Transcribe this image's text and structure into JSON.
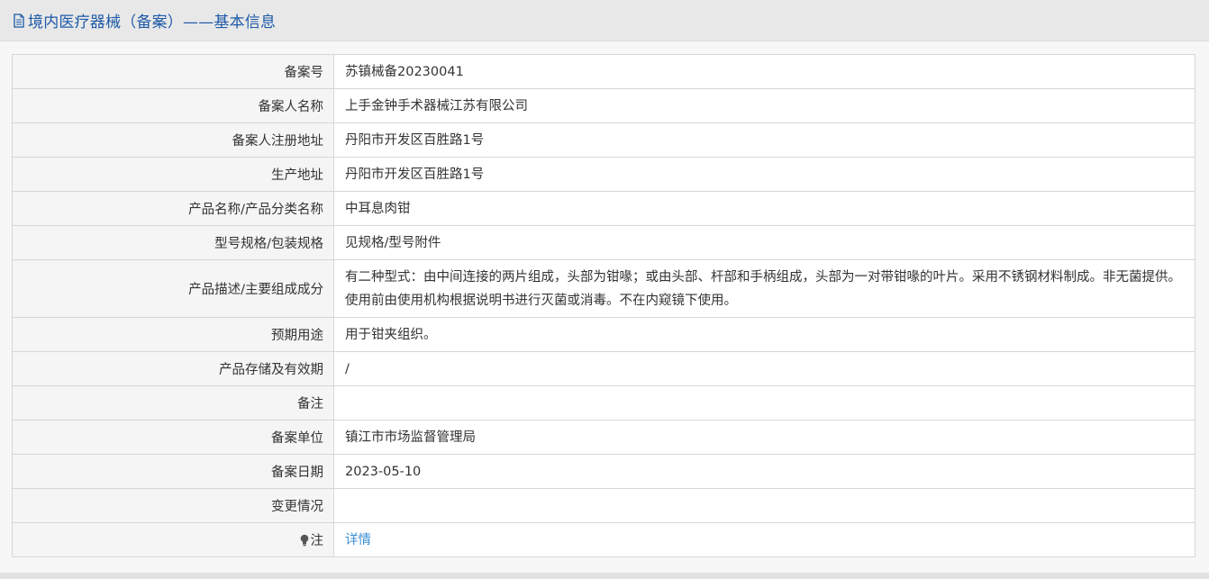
{
  "header": {
    "title": "境内医疗器械（备案）——基本信息",
    "icon": "document-icon"
  },
  "fields": [
    {
      "label": "备案号",
      "value": "苏镇械备20230041"
    },
    {
      "label": "备案人名称",
      "value": "上手金钟手术器械江苏有限公司"
    },
    {
      "label": "备案人注册地址",
      "value": "丹阳市开发区百胜路1号"
    },
    {
      "label": "生产地址",
      "value": "丹阳市开发区百胜路1号"
    },
    {
      "label": "产品名称/产品分类名称",
      "value": "中耳息肉钳"
    },
    {
      "label": "型号规格/包装规格",
      "value": "见规格/型号附件"
    },
    {
      "label": "产品描述/主要组成成分",
      "value": "有二种型式：由中间连接的两片组成，头部为钳喙；或由头部、杆部和手柄组成，头部为一对带钳喙的叶片。采用不锈钢材料制成。非无菌提供。使用前由使用机构根据说明书进行灭菌或消毒。不在内窥镜下使用。"
    },
    {
      "label": "预期用途",
      "value": "用于钳夹组织。"
    },
    {
      "label": "产品存储及有效期",
      "value": "/"
    },
    {
      "label": "备注",
      "value": ""
    },
    {
      "label": "备案单位",
      "value": "镇江市市场监督管理局"
    },
    {
      "label": "备案日期",
      "value": "2023-05-10"
    },
    {
      "label": "变更情况",
      "value": ""
    }
  ],
  "note": {
    "label": "注",
    "icon": "lightbulb-icon",
    "link_text": "详情"
  },
  "colors": {
    "title": "#1e5aa8",
    "link": "#3c8fd6",
    "border": "#d6d6d6",
    "label_bg": "#f5f5f5"
  }
}
